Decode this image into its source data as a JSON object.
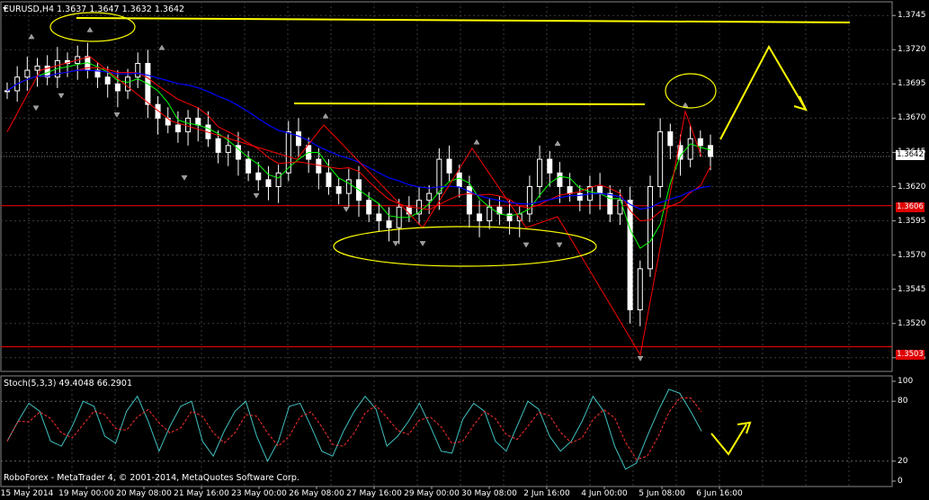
{
  "header": {
    "symbol_label": "EURUSD,H4  1.3637 1.3647 1.3632 1.3642",
    "stoch_label": "Stoch(5,3,3) 49.4048 66.2901",
    "copyright": "RoboForex - MetaTrader 4, © 2001-2014, MetaQuotes Software Corp."
  },
  "price_axis": [
    "1.3745",
    "1.3720",
    "1.3695",
    "1.3670",
    "1.3645",
    "1.3620",
    "1.3595",
    "1.3570",
    "1.3545",
    "1.3520",
    "1.3495"
  ],
  "price_boxes": {
    "current": "1.3642",
    "support": "1.3606",
    "low": "1.3503"
  },
  "stoch_axis": [
    "100",
    "80",
    "20",
    "0"
  ],
  "time_axis": [
    "15 May 2014",
    "19 May 00:00",
    "20 May 08:00",
    "21 May 16:00",
    "23 May 00:00",
    "26 May 08:00",
    "27 May 16:00",
    "29 May 00:00",
    "30 May 08:00",
    "2 Jun 16:00",
    "4 Jun 00:00",
    "5 Jun 08:00",
    "6 Jun 16:00"
  ],
  "colors": {
    "background": "#000000",
    "grid": "#3a3a3a",
    "bull_candle": "#ffffff",
    "bear_candle": "#ffffff",
    "ma_fast": "#00ff00",
    "ma_mid": "#ff0000",
    "ma_slow": "#0000ff",
    "annotation": "#ffff00",
    "zigzag": "#ff0000",
    "stoch_main": "#40c0c0",
    "stoch_signal": "#ff3030",
    "level_line": "#ff0000"
  },
  "chart_data": [
    {
      "type": "candlestick",
      "title": "EURUSD,H4",
      "y_range": [
        1.3485,
        1.3755
      ],
      "horizontal_levels": [
        1.3606,
        1.3503
      ],
      "price_points_approx": [
        1.369,
        1.37,
        1.3705,
        1.3708,
        1.37,
        1.3712,
        1.371,
        1.3715,
        1.3705,
        1.37,
        1.3695,
        1.369,
        1.37,
        1.371,
        1.368,
        1.367,
        1.3665,
        1.366,
        1.367,
        1.3665,
        1.3655,
        1.3645,
        1.365,
        1.364,
        1.363,
        1.3625,
        1.362,
        1.363,
        1.366,
        1.365,
        1.364,
        1.363,
        1.362,
        1.3615,
        1.3625,
        1.361,
        1.36,
        1.3595,
        1.359,
        1.3605,
        1.36,
        1.361,
        1.3615,
        1.364,
        1.363,
        1.362,
        1.36,
        1.3595,
        1.3605,
        1.36,
        1.3595,
        1.36,
        1.362,
        1.364,
        1.363,
        1.362,
        1.3615,
        1.361,
        1.362,
        1.3615,
        1.36,
        1.361,
        1.353,
        1.356,
        1.362,
        1.366,
        1.365,
        1.364,
        1.3655,
        1.365,
        1.3642
      ]
    },
    {
      "type": "line",
      "title": "Stoch(5,3,3)",
      "y_range": [
        0,
        100
      ],
      "levels": [
        20,
        80
      ]
    }
  ]
}
